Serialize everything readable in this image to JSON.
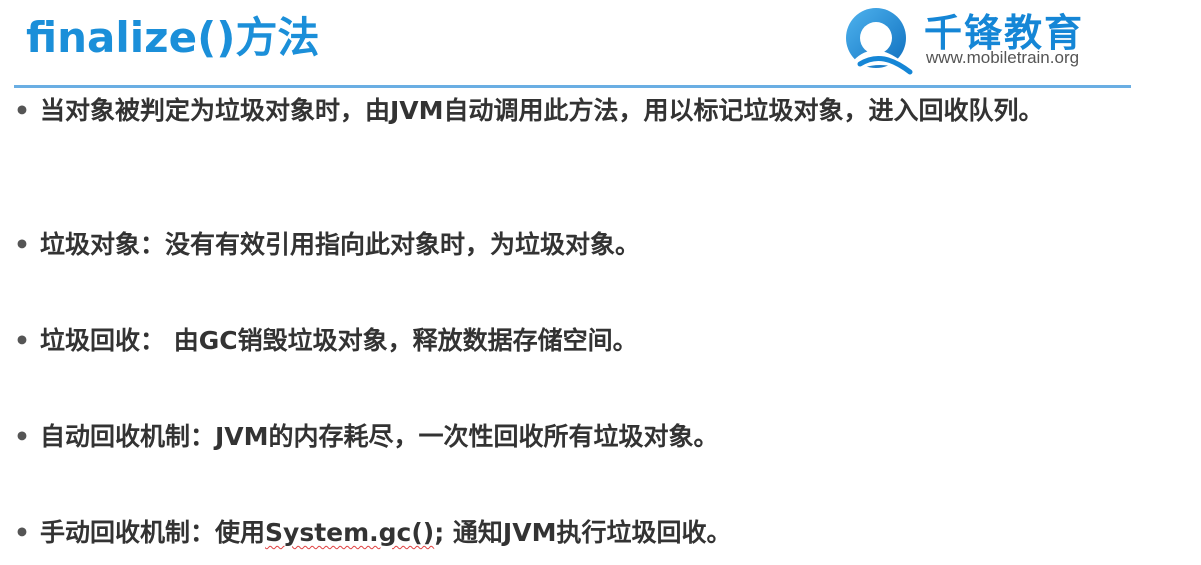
{
  "slide": {
    "title": "finalize()方法",
    "logo": {
      "cn_name": "千锋教育",
      "url": "www.mobiletrain.org",
      "icon": "mobiletrain-q-logo-icon",
      "brand_color": "#1586d6"
    },
    "accent_color": "#1b8fd9",
    "bullet_glyph": "•",
    "bullets": [
      {
        "text": "当对象被判定为垃圾对象时，由JVM自动调用此方法，用以标记垃圾对象，进入回收队列。"
      },
      {
        "text": "垃圾对象：没有有效引用指向此对象时，为垃圾对象。"
      },
      {
        "text": "垃圾回收： 由GC销毁垃圾对象，释放数据存储空间。"
      },
      {
        "text": "自动回收机制：JVM的内存耗尽，一次性回收所有垃圾对象。"
      },
      {
        "prefix": "手动回收机制：使用",
        "code": "System.gc()",
        "suffix": "; 通知JVM执行垃圾回收。"
      }
    ]
  }
}
